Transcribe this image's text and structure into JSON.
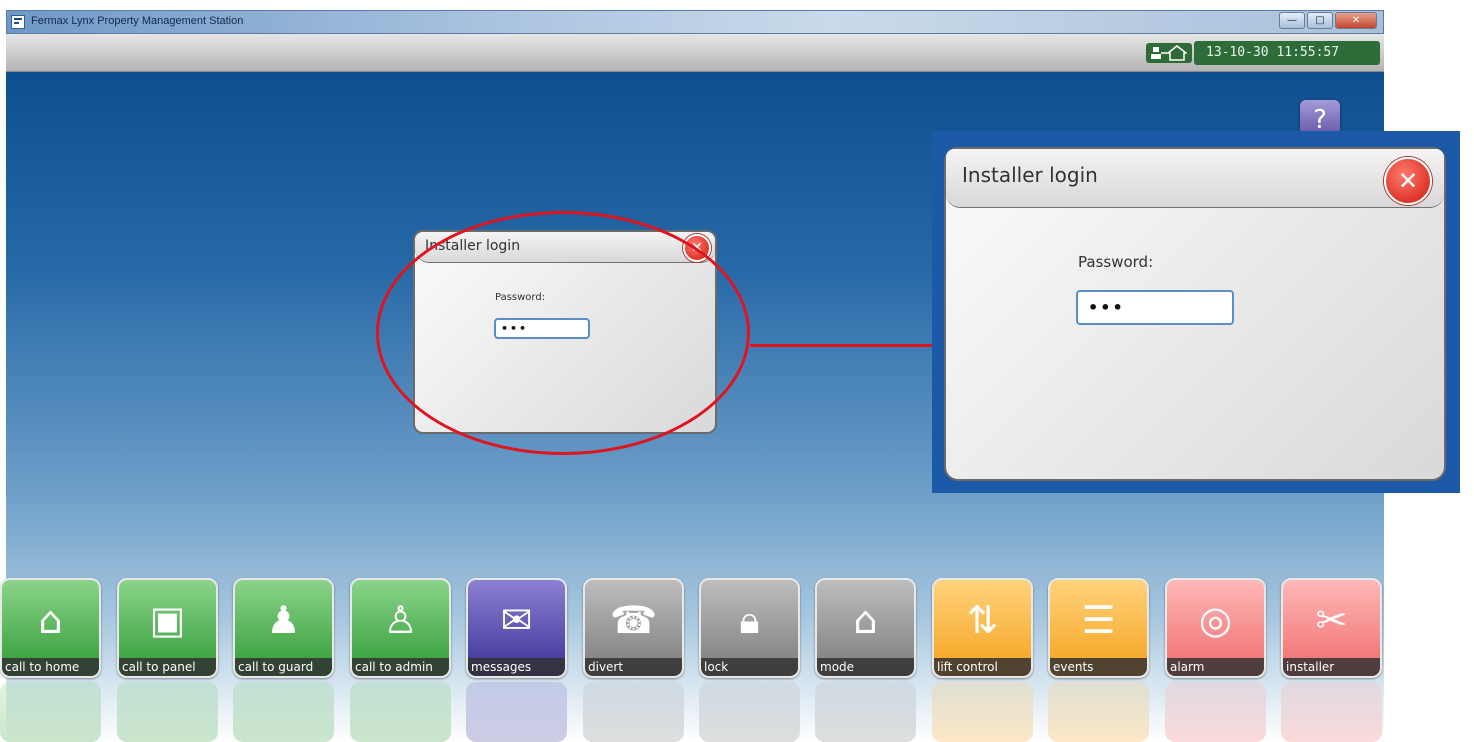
{
  "window": {
    "title": "Fermax Lynx Property Management Station",
    "minimize": "—",
    "maximize": "□",
    "close": "✕"
  },
  "status": {
    "datetime": "13-10-30 11:55:57",
    "connection_icon": "network-house-icon"
  },
  "help": {
    "label": "?"
  },
  "login_dialog": {
    "title": "Installer login",
    "password_label": "Password:",
    "password_value": "•••"
  },
  "zoom_dialog": {
    "title": "Installer login",
    "password_label": "Password:",
    "password_value": "•••"
  },
  "toolbar": {
    "items": [
      {
        "label": "call to home",
        "icon": "house-bell-icon",
        "color": "green"
      },
      {
        "label": "call to panel",
        "icon": "panel-bell-icon",
        "color": "green"
      },
      {
        "label": "call to guard",
        "icon": "guard-bell-icon",
        "color": "green"
      },
      {
        "label": "call to admin",
        "icon": "admin-bell-icon",
        "color": "green"
      },
      {
        "label": "messages",
        "icon": "envelope-icon",
        "color": "purple"
      },
      {
        "label": "divert",
        "icon": "phone-divert-icon",
        "color": "gray"
      },
      {
        "label": "lock",
        "icon": "lock-icon",
        "color": "gray"
      },
      {
        "label": "mode",
        "icon": "house-gear-icon",
        "color": "gray"
      },
      {
        "label": "lift control",
        "icon": "lift-icon",
        "color": "orange"
      },
      {
        "label": "events",
        "icon": "documents-icon",
        "color": "orange"
      },
      {
        "label": "alarm",
        "icon": "alarm-bell-icon",
        "color": "red"
      },
      {
        "label": "installer",
        "icon": "tools-icon",
        "color": "red"
      }
    ]
  },
  "colors": {
    "highlight": "#e0141e",
    "zoom_panel": "#1c5aa8"
  }
}
